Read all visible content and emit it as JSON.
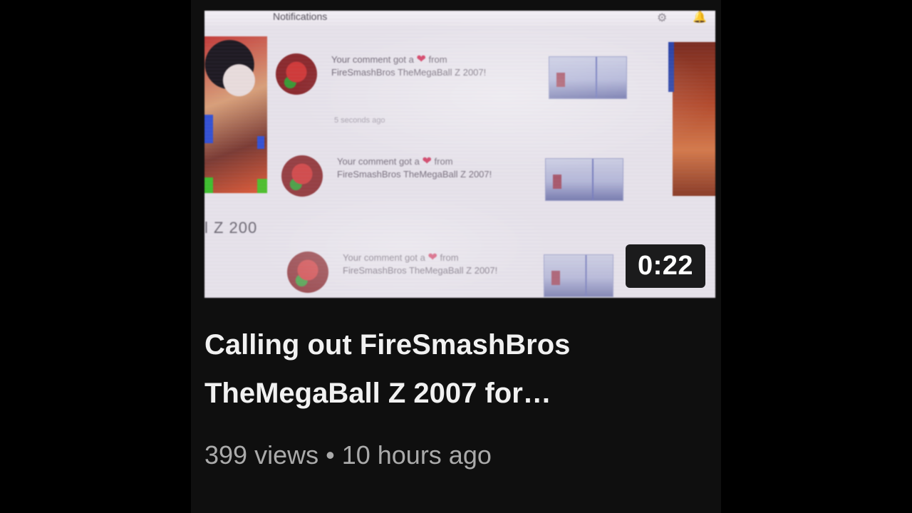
{
  "thumbnail": {
    "header_title": "Notifications",
    "gear_icon": "gear-icon",
    "bell_icon": "bell-icon",
    "left_text": "l Z 200",
    "notifications": [
      {
        "prefix": "Your comment got a",
        "heart": "❤",
        "suffix": "from FireSmashBros TheMegaBall Z 2007!",
        "time": "5 seconds ago"
      },
      {
        "prefix": "Your comment got a",
        "heart": "❤",
        "suffix": "from FireSmashBros TheMegaBall Z 2007!",
        "time": ""
      },
      {
        "prefix": "Your comment got a",
        "heart": "❤",
        "suffix": "from FireSmashBros TheMegaBall Z 2007!",
        "time": ""
      }
    ]
  },
  "video": {
    "duration": "0:22",
    "title_line1": "Calling out FireSmashBros",
    "title_line2": "TheMegaBall Z 2007 for…",
    "views": "399 views",
    "separator": "•",
    "age": "10 hours ago"
  },
  "colors": {
    "background": "#000000",
    "card_background": "#0f0f0f",
    "title": "#f1f1f1",
    "meta": "#aaaaaa",
    "heart": "#d0345a"
  }
}
